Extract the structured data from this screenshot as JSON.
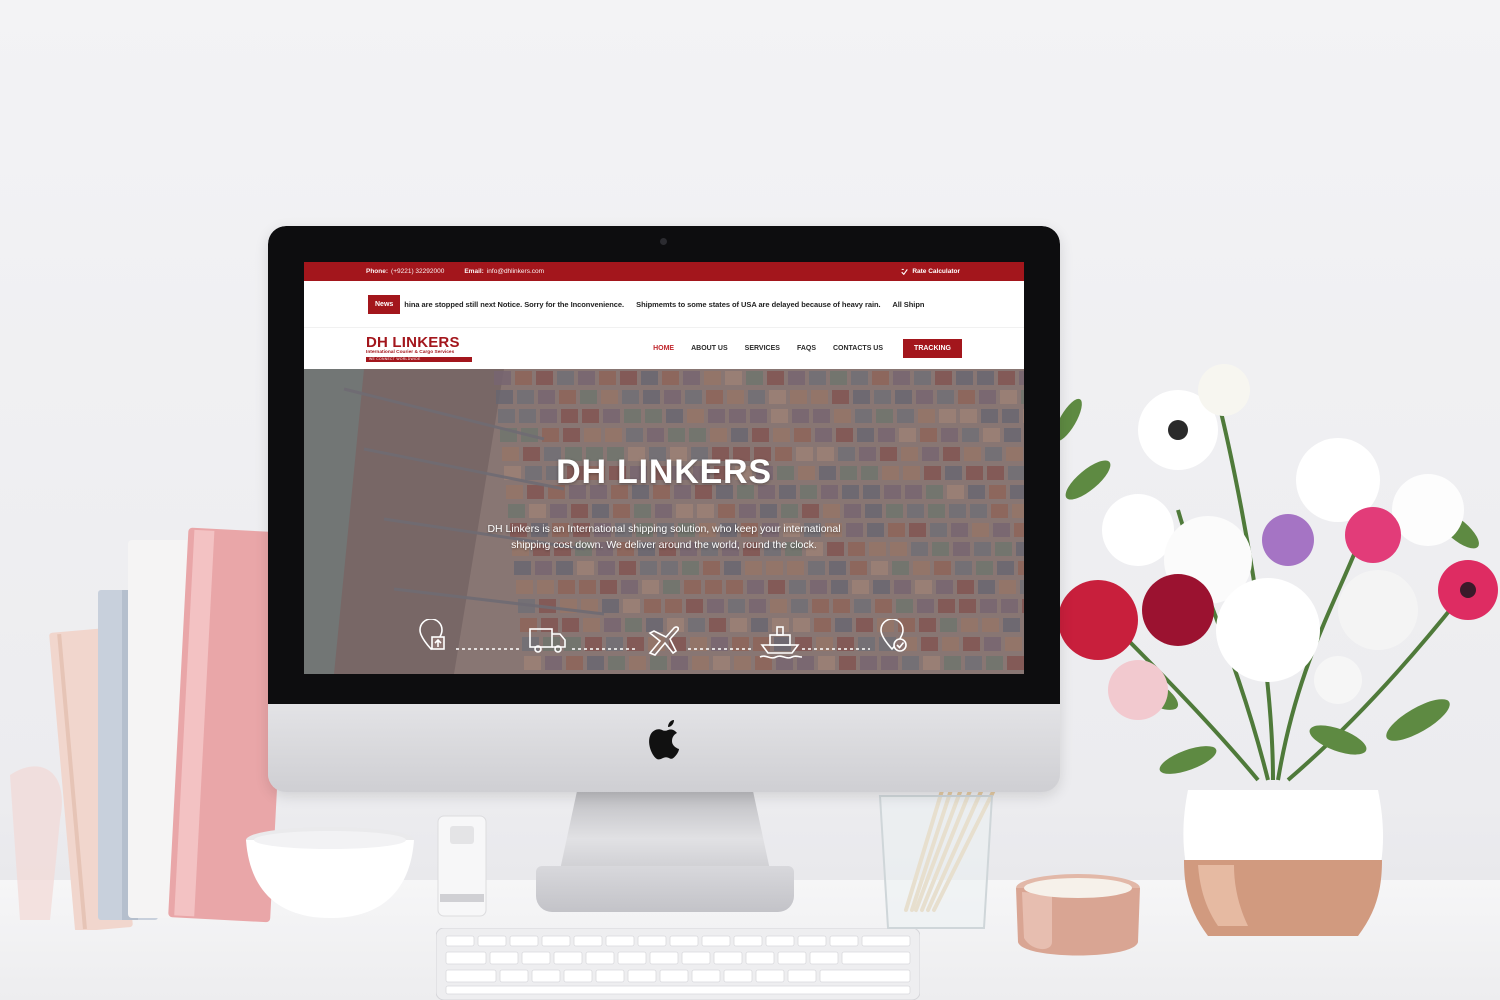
{
  "topbar": {
    "phone_label": "Phone:",
    "phone_value": "(+9221) 32292000",
    "email_label": "Email:",
    "email_value": "info@dhlinkers.com",
    "rate_calculator": "Rate Calculator"
  },
  "news": {
    "label": "News",
    "items": [
      "hina are stopped still next Notice. Sorry for the Inconvenience.",
      "Shipmemts to some states of USA are delayed because of heavy rain.",
      "All Shipn"
    ]
  },
  "logo": {
    "title": "DH LINKERS",
    "subtitle": "International Courier & Cargo Services",
    "tagline": "WE CONNECT WORLDWIDE"
  },
  "nav": {
    "items": [
      "HOME",
      "ABOUT US",
      "SERVICES",
      "FAQS",
      "CONTACTS US"
    ],
    "active": "HOME",
    "tracking": "TRACKING"
  },
  "hero": {
    "title": "DH LINKERS",
    "description": "DH Linkers is an International shipping solution, who keep your international shipping cost down. We deliver around the world, round the clock.",
    "step_icons": [
      "location-upload-icon",
      "truck-icon",
      "airplane-icon",
      "ship-icon",
      "location-check-icon"
    ]
  },
  "colors": {
    "brand_red": "#a3161c",
    "active_nav": "#c0262d"
  }
}
